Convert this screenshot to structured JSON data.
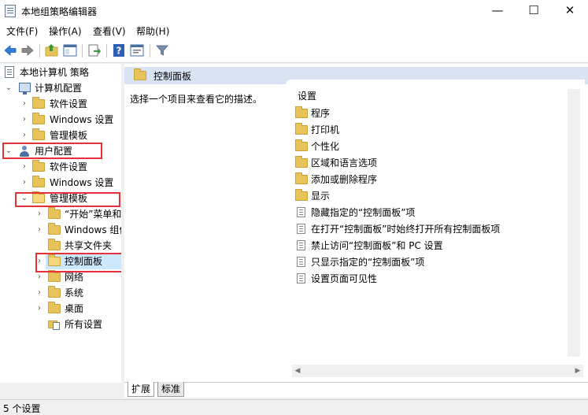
{
  "window": {
    "title": "本地组策略编辑器",
    "minimize": "—",
    "maximize": "☐",
    "close": "✕"
  },
  "menu": [
    "文件(F)",
    "操作(A)",
    "查看(V)",
    "帮助(H)"
  ],
  "toolbar": {
    "icons": [
      "back-arrow-icon",
      "forward-arrow-icon",
      "up-folder-icon",
      "show-hide-tree-icon",
      "export-list-icon",
      "help-icon",
      "properties-icon",
      "filter-icon"
    ]
  },
  "tree": {
    "root": "本地计算机 策略",
    "computer_config": "计算机配置",
    "computer_children": [
      "软件设置",
      "Windows 设置",
      "管理模板"
    ],
    "user_config": "用户配置",
    "user_children": [
      "软件设置",
      "Windows 设置",
      "管理模板"
    ],
    "admin_template_children": [
      "“开始”菜单和",
      "Windows 组件",
      "共享文件夹",
      "控制面板",
      "网络",
      "系统",
      "桌面",
      "所有设置"
    ]
  },
  "right": {
    "header": "控制面板",
    "description": "选择一个项目来查看它的描述。",
    "column_header": "设置",
    "folders": [
      "程序",
      "打印机",
      "个性化",
      "区域和语言选项",
      "添加或删除程序",
      "显示"
    ],
    "settings": [
      "隐藏指定的“控制面板”项",
      "在打开“控制面板”时始终打开所有控制面板项",
      "禁止访问“控制面板”和 PC 设置",
      "只显示指定的“控制面板”项",
      "设置页面可见性"
    ],
    "tabs": [
      "扩展",
      "标准"
    ]
  },
  "status": "5 个设置",
  "colors": {
    "highlight_box": "#e8303a",
    "selection": "#cce8ff",
    "header_band": "#d8e3f3"
  }
}
